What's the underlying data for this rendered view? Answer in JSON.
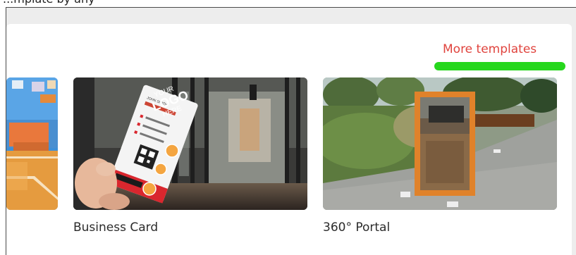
{
  "header": {
    "cut_text": "...mplate by any"
  },
  "more_link": {
    "label": "More templates"
  },
  "cards": [
    {
      "label": ""
    },
    {
      "label": "Business Card",
      "card_name": "JOHN SMITH",
      "card_logo_line1": "YOUR",
      "card_logo_line2": "LOGO",
      "card_logo_line3": "HERE"
    },
    {
      "label": "360° Portal"
    }
  ],
  "colors": {
    "accent_link": "#e0443e",
    "highlight": "#26d71d",
    "portal_frame": "#e0822a"
  }
}
